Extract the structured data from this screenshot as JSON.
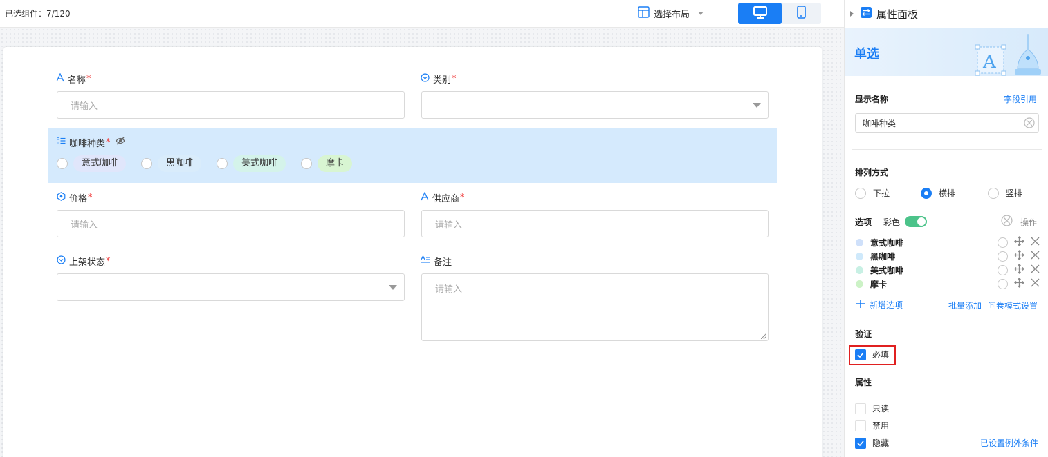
{
  "toolbar": {
    "selected_count": "已选组件：7/120",
    "layout_label": "选择布局",
    "devices": [
      "desktop",
      "mobile"
    ],
    "active_device": "desktop"
  },
  "form": {
    "fields": {
      "name": {
        "label": "名称",
        "required": "*",
        "placeholder": "请输入",
        "icon": "text-icon"
      },
      "category": {
        "label": "类别",
        "required": "*",
        "icon": "dropdown-circle-icon"
      },
      "coffee_type": {
        "label": "咖啡种类",
        "required": "*",
        "icon": "radio-list-icon",
        "options": [
          {
            "label": "意式咖啡",
            "color": "#e0e6fb"
          },
          {
            "label": "黑咖啡",
            "color": "#d9ecfb"
          },
          {
            "label": "美式咖啡",
            "color": "#d4f3ea"
          },
          {
            "label": "摩卡",
            "color": "#d8f5d2"
          }
        ]
      },
      "price": {
        "label": "价格",
        "required": "*",
        "placeholder": "请输入",
        "icon": "number-icon"
      },
      "supplier": {
        "label": "供应商",
        "required": "*",
        "placeholder": "请输入",
        "icon": "text-icon"
      },
      "status": {
        "label": "上架状态",
        "required": "*",
        "icon": "dropdown-circle-icon"
      },
      "remark": {
        "label": "备注",
        "placeholder": "请输入",
        "icon": "multiline-text-icon"
      }
    }
  },
  "panel": {
    "title": "属性面板",
    "banner_title": "单选",
    "display_name_label": "显示名称",
    "field_ref_link": "字段引用",
    "display_name_value": "咖啡种类",
    "arrange_label": "排列方式",
    "arrange_options": [
      "下拉",
      "横排",
      "竖排"
    ],
    "arrange_selected": "横排",
    "options_label": "选项",
    "color_label": "彩色",
    "color_on": true,
    "operate_label": "操作",
    "options": [
      {
        "label": "意式咖啡",
        "dot": "#cfe0fa"
      },
      {
        "label": "黑咖啡",
        "dot": "#cfe9fb"
      },
      {
        "label": "美式咖啡",
        "dot": "#c8f0e4"
      },
      {
        "label": "摩卡",
        "dot": "#ccf2c6"
      }
    ],
    "add_option": "新增选项",
    "batch_add": "批量添加",
    "questionnaire": "问卷模式设置",
    "validation_label": "验证",
    "required_label": "必填",
    "required_checked": true,
    "attr_label": "属性",
    "readonly_label": "只读",
    "disabled_label": "禁用",
    "hidden_label": "隐藏",
    "hidden_checked": true,
    "exception_link": "已设置例外条件"
  },
  "colors": {
    "accent": "#1a7ef5",
    "selected_bg": "#d5eafd",
    "toggle_on": "#4cc38a",
    "highlight": "#e02020"
  }
}
